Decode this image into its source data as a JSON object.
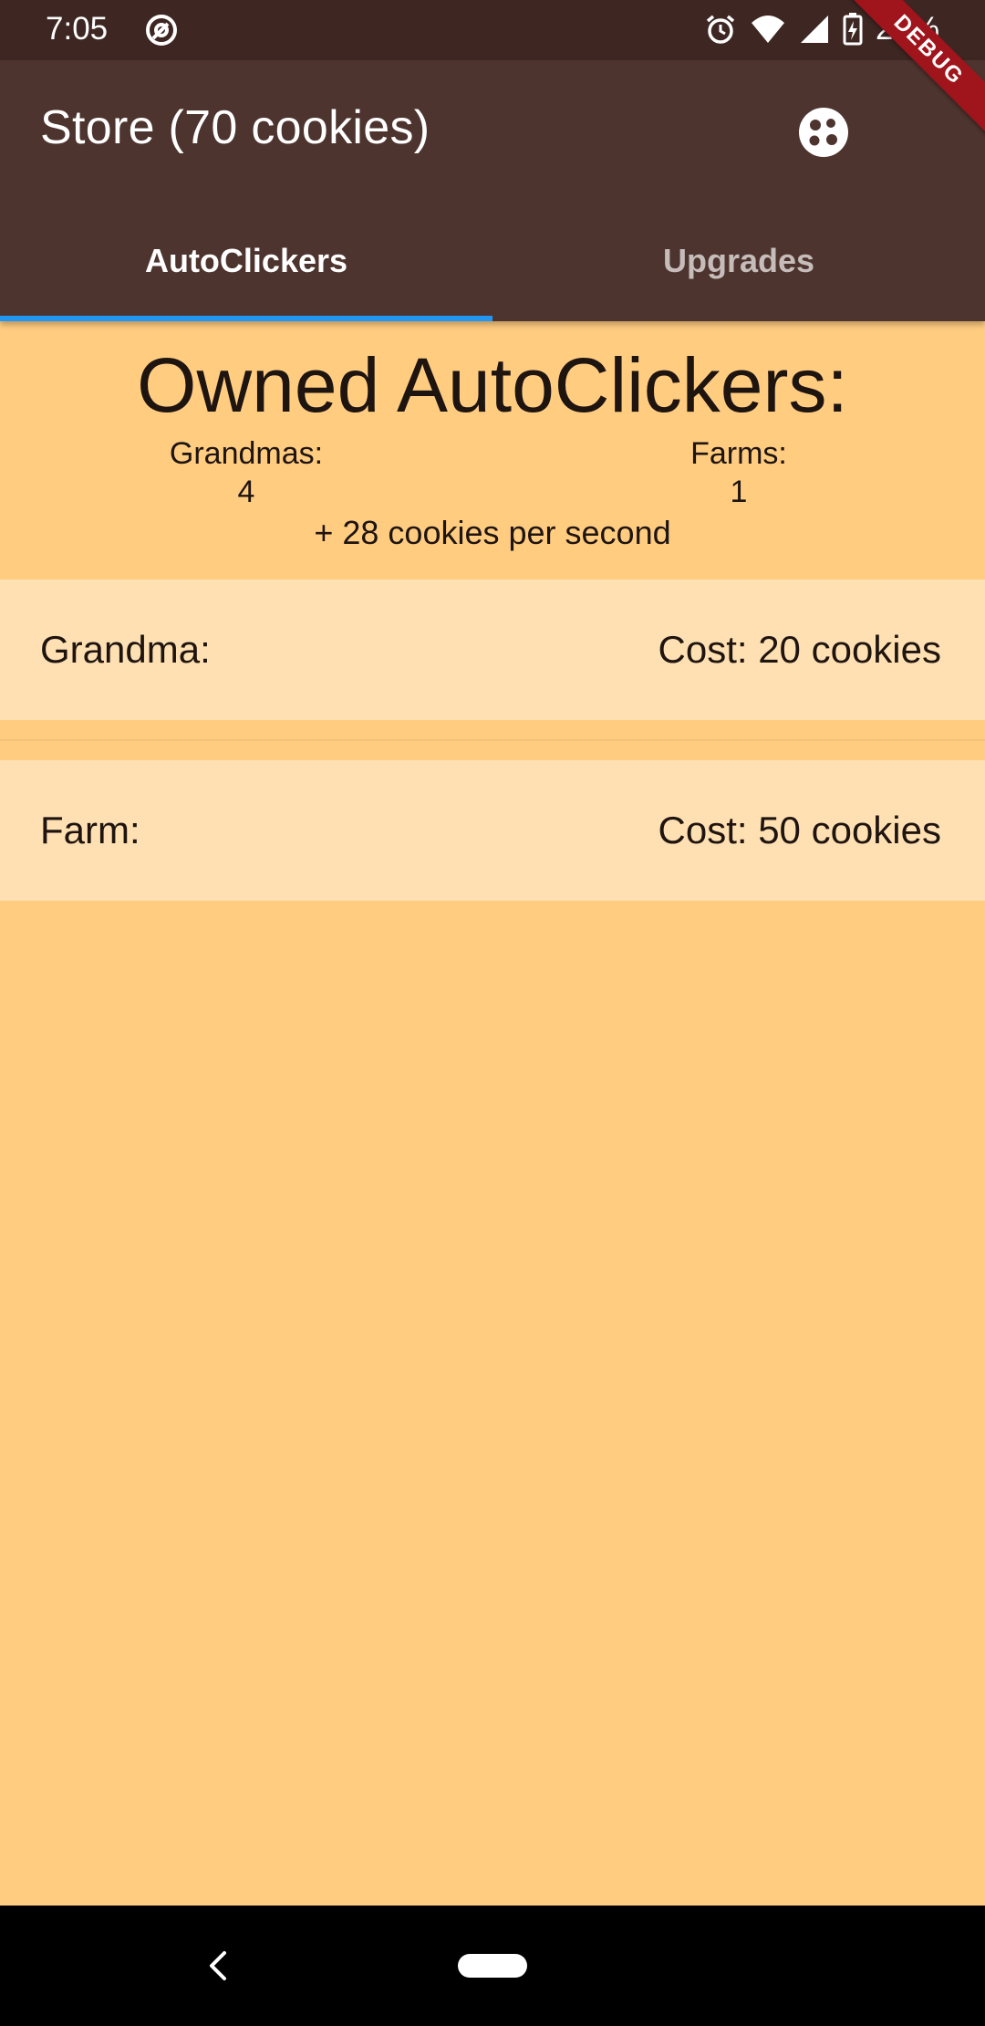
{
  "status_bar": {
    "time": "7:05",
    "battery": "29%",
    "icons": [
      "at-sign-icon",
      "alarm-icon",
      "wifi-icon",
      "signal-icon",
      "battery-charging-icon"
    ]
  },
  "app_bar": {
    "title": "Store (70 cookies)",
    "action_icon": "cookie-icon",
    "debug_banner": "DEBUG"
  },
  "tabs": [
    {
      "label": "AutoClickers",
      "selected": true
    },
    {
      "label": "Upgrades",
      "selected": false
    }
  ],
  "owned": {
    "title": "Owned AutoClickers:",
    "grandmas_label": "Grandmas:",
    "grandmas_count": "4",
    "farms_label": "Farms:",
    "farms_count": "1",
    "rate": "+ 28 cookies per second"
  },
  "items": [
    {
      "name": "Grandma:",
      "cost": "Cost: 20 cookies"
    },
    {
      "name": "Farm:",
      "cost": "Cost: 50 cookies"
    }
  ],
  "nav_bar": {
    "icons": [
      "back-icon",
      "home-pill"
    ]
  },
  "colors": {
    "status_bar": "#3e2723",
    "app_bar": "#4e342e",
    "background": "#ffcc80",
    "item_background": "#ffe0b2",
    "tab_indicator": "#2196f3",
    "debug_banner": "#a0141c"
  }
}
